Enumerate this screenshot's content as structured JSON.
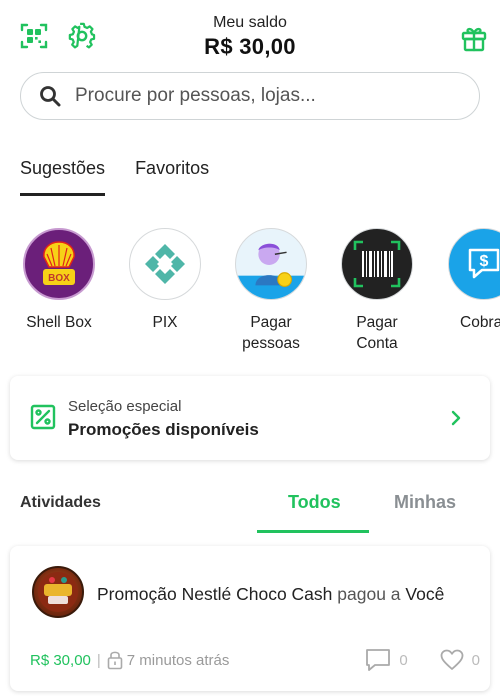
{
  "header": {
    "balance_label": "Meu saldo",
    "balance_value": "R$ 30,00",
    "icons": [
      "qr-scan-icon",
      "gear-icon",
      "gift-icon"
    ]
  },
  "search": {
    "placeholder": "Procure por pessoas, lojas..."
  },
  "tabs": [
    {
      "label": "Sugestões",
      "active": true
    },
    {
      "label": "Favoritos",
      "active": false
    }
  ],
  "shortcuts": [
    {
      "label_line1": "Shell Box",
      "label_line2": "",
      "badge": "BOX"
    },
    {
      "label_line1": "PIX",
      "label_line2": ""
    },
    {
      "label_line1": "Pagar",
      "label_line2": "pessoas"
    },
    {
      "label_line1": "Pagar",
      "label_line2": "Conta"
    },
    {
      "label_line1": "Cobra",
      "label_line2": ""
    }
  ],
  "promo": {
    "subtitle": "Seleção especial",
    "title": "Promoções disponíveis"
  },
  "activity": {
    "label": "Atividades",
    "tabs": [
      {
        "label": "Todos",
        "active": true
      },
      {
        "label": "Minhas",
        "active": false
      }
    ]
  },
  "feed": [
    {
      "sender": "Promoção Nestlé Choco Cash",
      "verb": "pagou a",
      "receiver": "Você",
      "amount": "R$ 30,00",
      "separator": "|",
      "time": "7 minutos atrás",
      "comments": "0",
      "likes": "0"
    }
  ],
  "colors": {
    "accent": "#21c25e",
    "muted_tab": "#8a8f93",
    "shell_purple": "#6b1f7a",
    "pix_teal": "#4fb6a8",
    "cobrar_blue": "#1aa3e8"
  }
}
